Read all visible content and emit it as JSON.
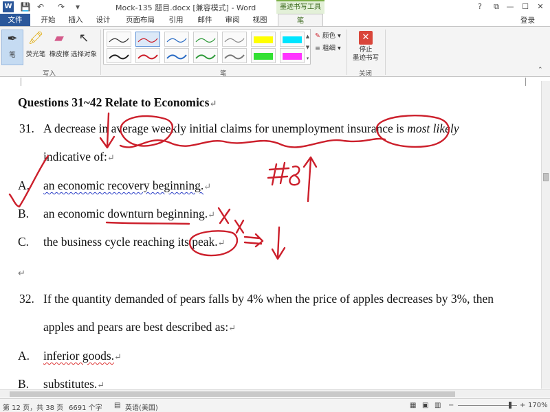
{
  "titlebar": {
    "app_icon": "W",
    "qat_icons": [
      "save-icon",
      "undo-icon",
      "redo-icon"
    ],
    "title": "Mock-135 题目.docx [兼容模式] - Word",
    "context_tab_group": "墨迹书写工具",
    "window_buttons": [
      "?",
      "⧉",
      "—",
      "☐",
      "✕"
    ]
  },
  "tabs": [
    {
      "label": "文件"
    },
    {
      "label": "开始"
    },
    {
      "label": "插入"
    },
    {
      "label": "设计"
    },
    {
      "label": "页面布局"
    },
    {
      "label": "引用"
    },
    {
      "label": "邮件"
    },
    {
      "label": "审阅"
    },
    {
      "label": "视图"
    },
    {
      "label": "笔"
    }
  ],
  "account": {
    "label": "登录"
  },
  "ribbon": {
    "write_group": {
      "label": "写入",
      "tools": [
        {
          "label": "笔",
          "icon": "pen-icon"
        },
        {
          "label": "荧光笔",
          "icon": "highlighter-icon"
        },
        {
          "label": "橡皮擦",
          "icon": "eraser-icon"
        },
        {
          "label": "选择对象",
          "icon": "select-object-icon"
        }
      ]
    },
    "pens_group": {
      "label": "笔",
      "color_label": "颜色",
      "thickness_label": "粗细"
    },
    "close_group": {
      "label": "关闭",
      "stop_label_line1": "停止",
      "stop_label_line2": "墨迹书写"
    }
  },
  "document": {
    "heading": "Questions 31~42 Relate to Economics",
    "q31": {
      "number": "31.",
      "text_a": "A decrease in average weekly initial claims for unemployment insurance is ",
      "text_italic": "most likely",
      "text_b": "indicative of:",
      "options": [
        {
          "letter": "A.",
          "text": "an economic recovery beginning."
        },
        {
          "letter": "B.",
          "text": "an economic downturn beginning."
        },
        {
          "letter": "C.",
          "text": "the business cycle reaching its peak."
        }
      ]
    },
    "q32": {
      "number": "32.",
      "text_a": "If the quantity demanded of pears falls by 4% when the price of apples decreases by 3%, then",
      "text_b": "apples and pears are best described as:",
      "options": [
        {
          "letter": "A.",
          "text": "inferior goods."
        },
        {
          "letter": "B.",
          "text": "substitutes."
        }
      ]
    },
    "ink_colors": {
      "red": "#cc1f2b"
    }
  },
  "statusbar": {
    "page": "第 12 页，共 38 页",
    "words": "6691 个字",
    "language": "英语(美国)",
    "zoom": "170%"
  }
}
